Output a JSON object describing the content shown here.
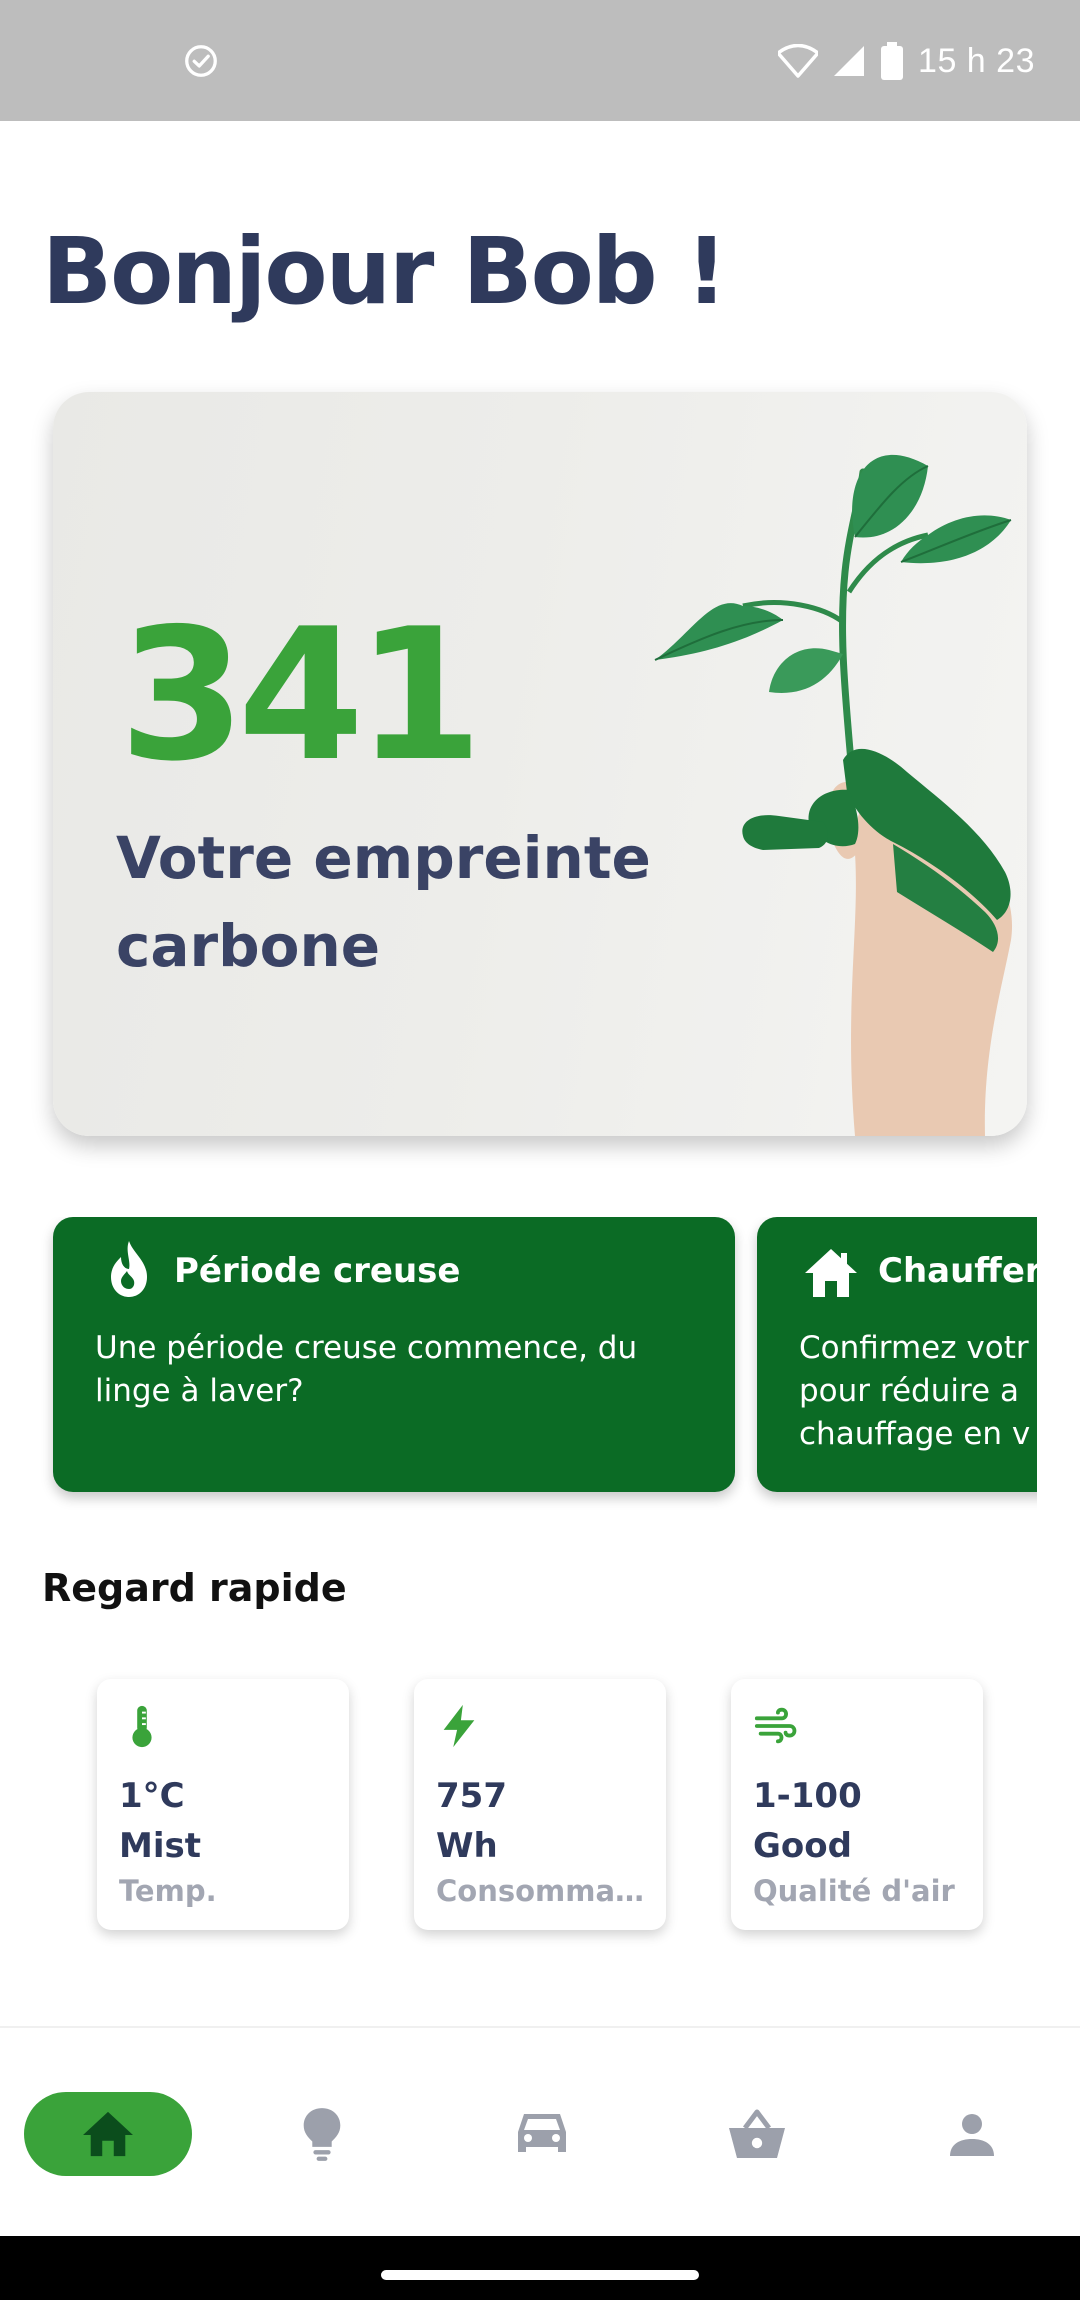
{
  "status_bar": {
    "time": "15 h 23",
    "icons": [
      "check-circle-icon",
      "wifi-icon",
      "signal-icon",
      "battery-icon"
    ]
  },
  "greeting": "Bonjour Bob !",
  "hero": {
    "value": "341",
    "label": "Votre empreinte carbone",
    "image": "green-painted-hand-holding-plant"
  },
  "suggestions": [
    {
      "icon": "flame-icon",
      "title": "Période creuse",
      "text": "Une période creuse commence, du linge à laver?"
    },
    {
      "icon": "home-icon",
      "title": "Chauffer",
      "text": "Confirmez votr pour réduire a chauffage en v"
    }
  ],
  "quick_look": {
    "title": "Regard rapide",
    "tiles": [
      {
        "icon": "thermometer-icon",
        "value": "1°C",
        "unit": "Mist",
        "caption": "Temp."
      },
      {
        "icon": "bolt-icon",
        "value": "757",
        "unit": "Wh",
        "caption": "Consommation"
      },
      {
        "icon": "wind-icon",
        "value": "1-100",
        "unit": "Good",
        "caption": "Qualité d'air"
      }
    ]
  },
  "nav": {
    "items": [
      "home-icon",
      "lightbulb-icon",
      "car-icon",
      "basket-icon",
      "person-icon"
    ],
    "active": "home-icon"
  },
  "colors": {
    "accent": "#3aa33a",
    "dark_green": "#0b6b25",
    "navy": "#2f3a5c",
    "muted": "#a2a6b2",
    "status_bar": "#bdbdbd"
  }
}
